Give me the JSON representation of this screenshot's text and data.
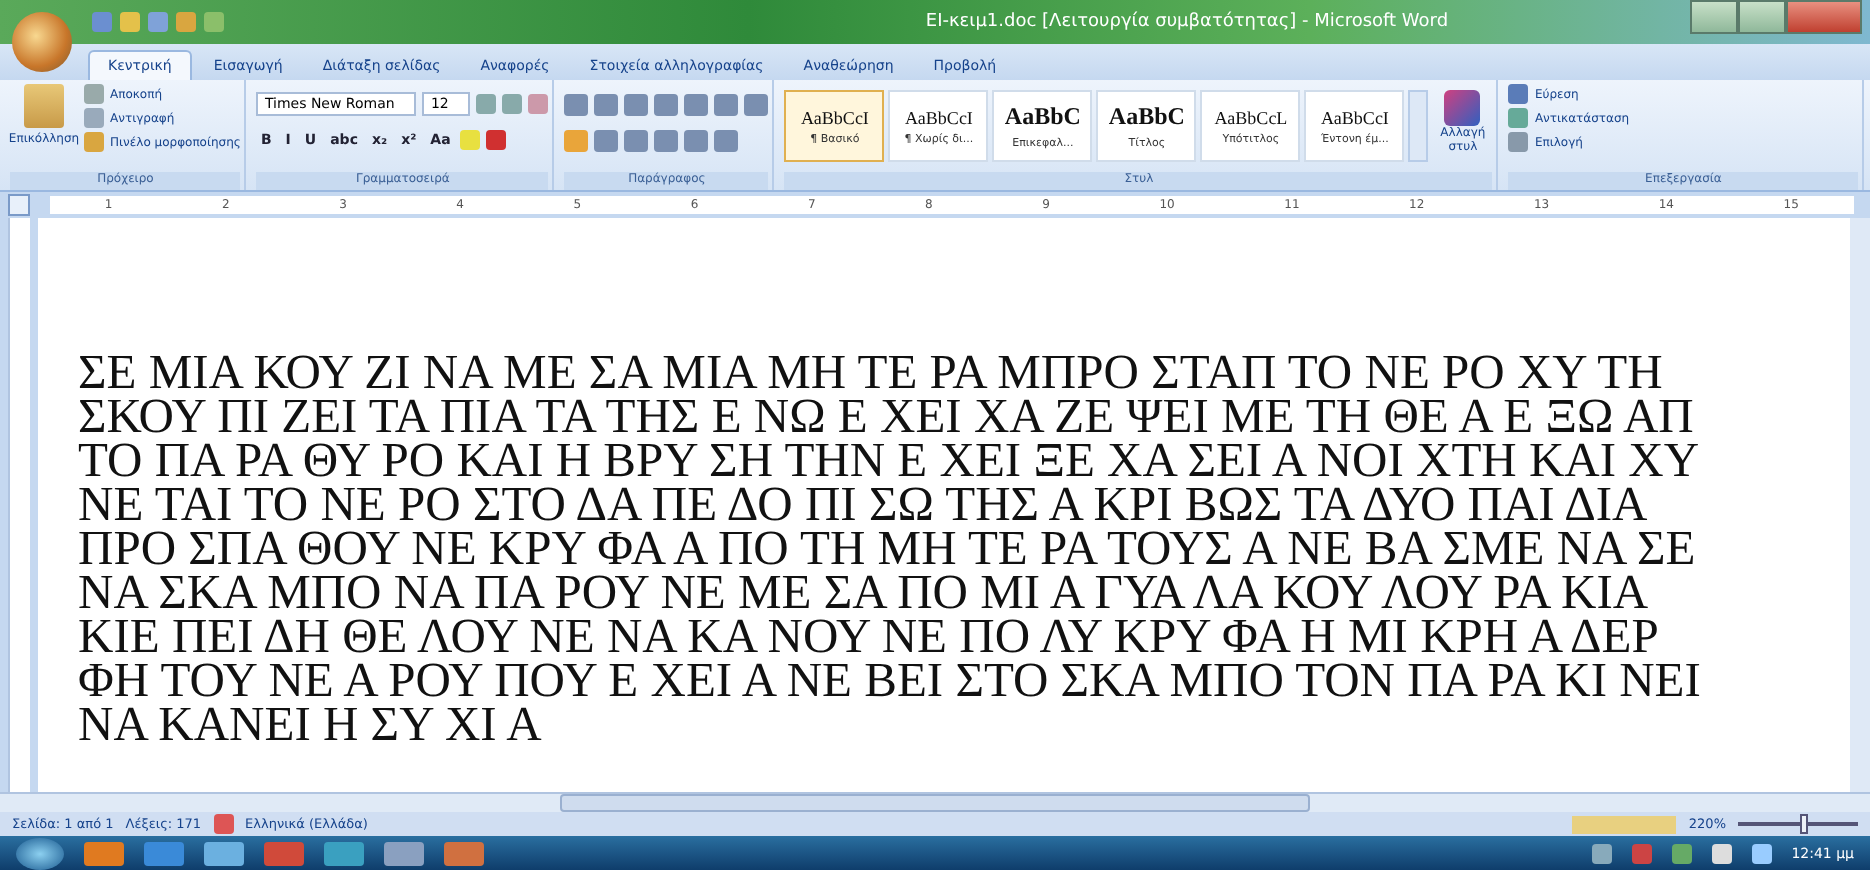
{
  "window": {
    "title": "ΕΙ-κειμ1.doc [Λειτουργία συμβατότητας] - Microsoft Word"
  },
  "tabs": [
    {
      "label": "Κεντρική",
      "selected": true
    },
    {
      "label": "Εισαγωγή",
      "selected": false
    },
    {
      "label": "Διάταξη σελίδας",
      "selected": false
    },
    {
      "label": "Αναφορές",
      "selected": false
    },
    {
      "label": "Στοιχεία αλληλογραφίας",
      "selected": false
    },
    {
      "label": "Αναθεώρηση",
      "selected": false
    },
    {
      "label": "Προβολή",
      "selected": false
    }
  ],
  "ribbon": {
    "clipboard": {
      "label": "Πρόχειρο",
      "paste": "Επικόλληση",
      "items": [
        "Αποκοπή",
        "Αντιγραφή",
        "Πινέλο μορφοποίησης"
      ]
    },
    "font": {
      "label": "Γραμματοσειρά",
      "font_name": "Times New Roman",
      "font_size": "12",
      "format_buttons": [
        "B",
        "I",
        "U",
        "abc",
        "x₂",
        "x²",
        "Aa"
      ]
    },
    "paragraph": {
      "label": "Παράγραφος"
    },
    "styles": {
      "label": "Στυλ",
      "change_styles": "Αλλαγή στυλ",
      "items": [
        {
          "preview": "AaBbCcI",
          "name": "¶ Βασικό",
          "selected": true
        },
        {
          "preview": "AaBbCcI",
          "name": "¶ Χωρίς δι...",
          "selected": false
        },
        {
          "preview": "AaBbC",
          "name": "Επικεφαλ...",
          "selected": false
        },
        {
          "preview": "AaBbC",
          "name": "Τίτλος",
          "selected": false
        },
        {
          "preview": "AaBbCcL",
          "name": "Υπότιτλος",
          "selected": false
        },
        {
          "preview": "AaBbCcI",
          "name": "Έντονη έμ...",
          "selected": false
        }
      ]
    },
    "editing": {
      "label": "Επεξεργασία",
      "items": [
        "Εύρεση",
        "Αντικατάσταση",
        "Επιλογή"
      ]
    }
  },
  "ruler": {
    "marks": [
      "1",
      "2",
      "3",
      "4",
      "5",
      "6",
      "7",
      "8",
      "9",
      "10",
      "11",
      "12",
      "13",
      "14",
      "15"
    ]
  },
  "document": {
    "lines": [
      "ΣΕ ΜΙΑ ΚΟΥ ΖΙ ΝΑ ΜΕ ΣΑ ΜΙΑ ΜΗ ΤΕ ΡΑ ΜΠΡΟ ΣΤΑΠ ΤΟ ΝΕ ΡΟ ΧΥ ΤΗ",
      "ΣΚΟΥ ΠΙ ΖΕΙ ΤΑ ΠΙΑ ΤΑ ΤΗΣ Ε ΝΩ Ε ΧΕΙ ΧΑ ΖΕ ΨΕΙ ΜΕ ΤΗ ΘΕ Α Ε ΞΩ ΑΠ",
      "ΤΟ ΠΑ ΡΑ ΘΥ ΡΟ ΚΑΙ Η ΒΡΥ ΣΗ ΤΗΝ Ε ΧΕΙ ΞΕ ΧΑ ΣΕΙ Α ΝΟΙ ΧΤΗ ΚΑΙ ΧΥ",
      "ΝΕ ΤΑΙ ΤΟ ΝΕ ΡΟ ΣΤΟ ΔΑ ΠΕ ΔΟ ΠΙ ΣΩ ΤΗΣ Α ΚΡΙ ΒΩΣ ΤΑ ΔΥΟ ΠΑΙ ΔΙΑ",
      "ΠΡΟ ΣΠΑ ΘΟΥ ΝΕ ΚΡΥ ΦΑ Α ΠΟ ΤΗ ΜΗ ΤΕ ΡΑ ΤΟΥΣ Α ΝΕ ΒΑ ΣΜΕ ΝΑ ΣΕ",
      "ΝΑ ΣΚΑ ΜΠΟ ΝΑ ΠΑ ΡΟΥ ΝΕ ΜΕ ΣΑ ΠΟ ΜΙ Α ΓΥΑ ΛΑ ΚΟΥ ΛΟΥ ΡΑ ΚΙΑ",
      "ΚΙΕ ΠΕΙ ΔΗ ΘΕ ΛΟΥ ΝΕ ΝΑ ΚΑ ΝΟΥ ΝΕ ΠΟ ΛΥ ΚΡΥ ΦΑ Η ΜΙ ΚΡΗ Α ΔΕΡ",
      "ΦΗ ΤΟΥ ΝΕ Α ΡΟΥ ΠΟΥ Ε ΧΕΙ Α ΝΕ ΒΕΙ ΣΤΟ ΣΚΑ ΜΠΟ ΤΟΝ ΠΑ ΡΑ ΚΙ ΝΕΙ",
      "ΝΑ ΚΑΝΕΙ Η ΣΥ ΧΙ Α"
    ]
  },
  "status_bar": {
    "page": "Σελίδα: 1 από 1",
    "words": "Λέξεις: 171",
    "language": "Ελληνικά (Ελλάδα)",
    "zoom": "220%",
    "zoom_slider": {
      "level": 0.55
    }
  },
  "taskbar": {
    "clock": "12:41 μμ"
  }
}
